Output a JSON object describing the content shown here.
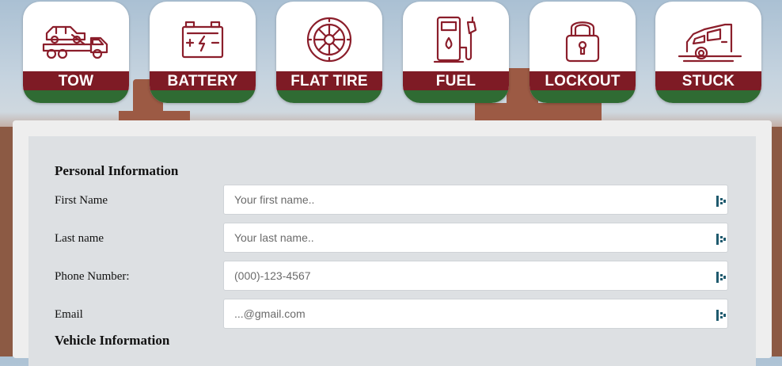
{
  "services": [
    {
      "label": "TOW",
      "icon": "tow-truck-icon"
    },
    {
      "label": "BATTERY",
      "icon": "battery-icon"
    },
    {
      "label": "FLAT TIRE",
      "icon": "tire-icon"
    },
    {
      "label": "FUEL",
      "icon": "fuel-pump-icon"
    },
    {
      "label": "LOCKOUT",
      "icon": "padlock-icon"
    },
    {
      "label": "STUCK",
      "icon": "stuck-car-icon"
    }
  ],
  "colors": {
    "brand_red": "#7e1b25",
    "brand_green": "#2f6b33",
    "icon_red": "#8b1e2b"
  },
  "form": {
    "personal_heading": "Personal Information",
    "first_name": {
      "label": "First Name",
      "placeholder": "Your first name.."
    },
    "last_name": {
      "label": "Last name",
      "placeholder": "Your last name.."
    },
    "phone": {
      "label": "Phone Number:",
      "placeholder": "(000)-123-4567"
    },
    "email": {
      "label": "Email",
      "placeholder": "...@gmail.com"
    },
    "vehicle_heading": "Vehicle Information"
  }
}
